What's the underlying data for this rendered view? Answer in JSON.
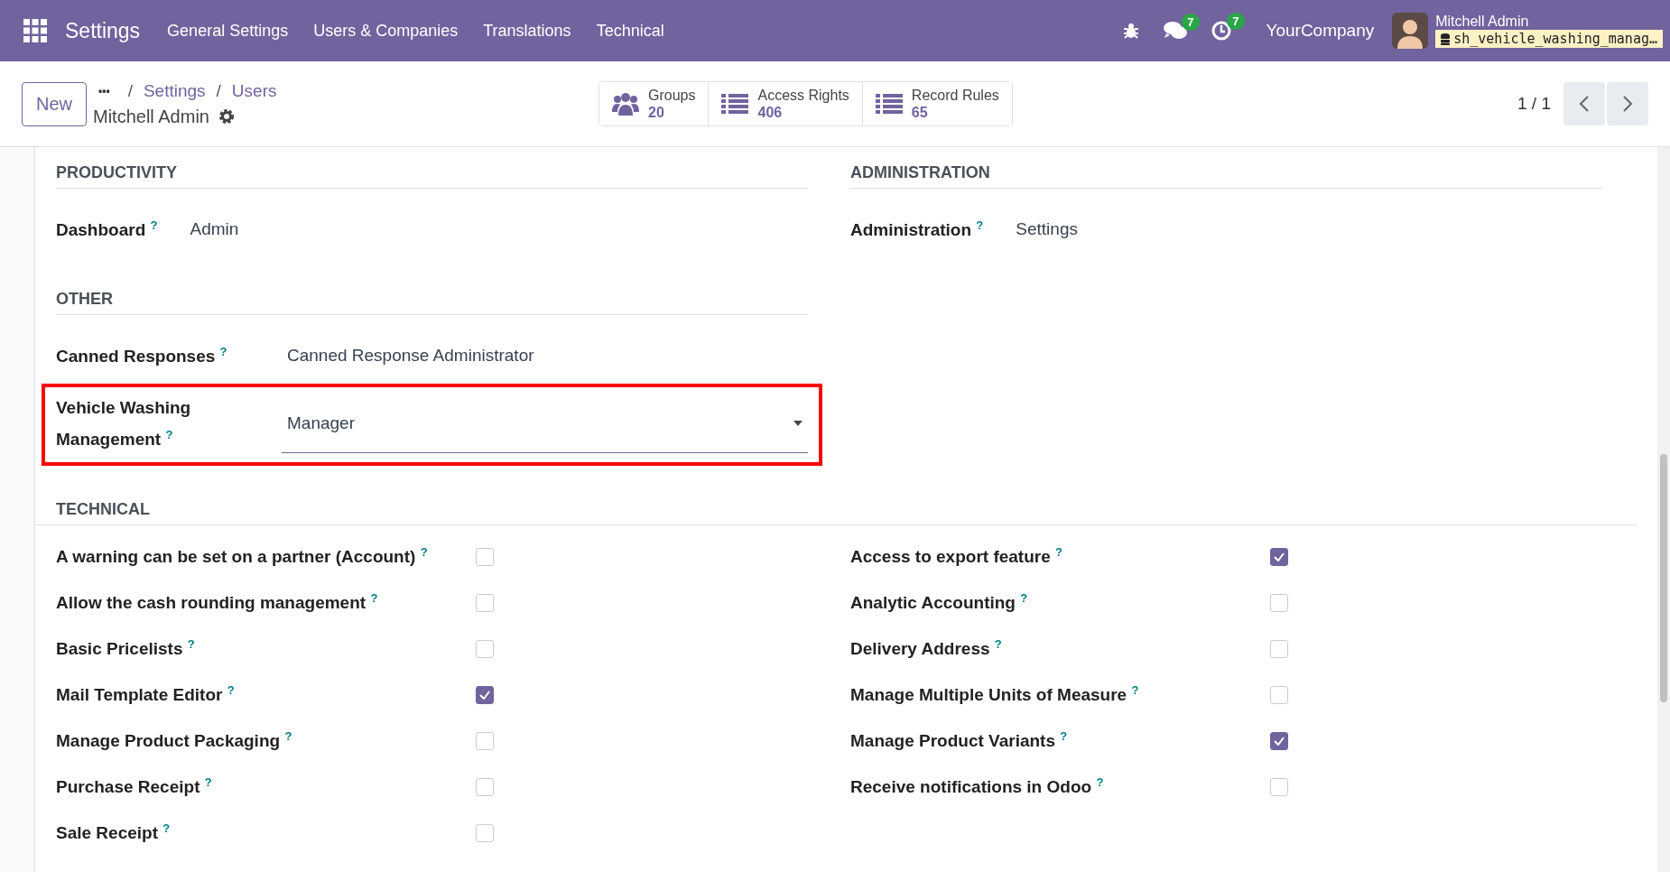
{
  "navbar": {
    "app_title": "Settings",
    "menus": [
      "General Settings",
      "Users & Companies",
      "Translations",
      "Technical"
    ],
    "messages_count": "7",
    "activities_count": "7",
    "company": "YourCompany",
    "user_name": "Mitchell Admin",
    "database": "sh_vehicle_washing_manag…"
  },
  "control_panel": {
    "new_button": "New",
    "breadcrumb_more": "•••",
    "breadcrumb_separator": "/",
    "breadcrumbs": [
      "Settings",
      "Users"
    ],
    "record_title": "Mitchell Admin",
    "stat_buttons": [
      {
        "kind": "users",
        "label": "Groups",
        "count": "20"
      },
      {
        "kind": "list",
        "label": "Access Rights",
        "count": "406"
      },
      {
        "kind": "list",
        "label": "Record Rules",
        "count": "65"
      }
    ],
    "pager": "1 / 1"
  },
  "sections": [
    {
      "title": "PRODUCTIVITY",
      "fields": [
        {
          "label": "Dashboard",
          "help": "?",
          "value": "Admin",
          "kind": "text",
          "highlighted": false
        }
      ]
    },
    {
      "title": "ADMINISTRATION",
      "fields": [
        {
          "label": "Administration",
          "help": "?",
          "value": "Settings",
          "kind": "text",
          "highlighted": false
        }
      ]
    },
    {
      "title": "OTHER",
      "fields": [
        {
          "label": "Canned Responses",
          "help": "?",
          "value": "Canned Response Administrator",
          "kind": "text",
          "highlighted": false
        },
        {
          "label": "Vehicle Washing Management",
          "help": "?",
          "value": "Manager",
          "kind": "select",
          "highlighted": true
        }
      ]
    }
  ],
  "technical": {
    "title": "TECHNICAL",
    "left": [
      {
        "label": "A warning can be set on a partner (Account)",
        "help": "?",
        "checked": false
      },
      {
        "label": "Allow the cash rounding management",
        "help": "?",
        "checked": false
      },
      {
        "label": "Basic Pricelists",
        "help": "?",
        "checked": false
      },
      {
        "label": "Mail Template Editor",
        "help": "?",
        "checked": true
      },
      {
        "label": "Manage Product Packaging",
        "help": "?",
        "checked": false
      },
      {
        "label": "Purchase Receipt",
        "help": "?",
        "checked": false
      },
      {
        "label": "Sale Receipt",
        "help": "?",
        "checked": false
      }
    ],
    "right": [
      {
        "label": "Access to export feature",
        "help": "?",
        "checked": true
      },
      {
        "label": "Analytic Accounting",
        "help": "?",
        "checked": false
      },
      {
        "label": "Delivery Address",
        "help": "?",
        "checked": false
      },
      {
        "label": "Manage Multiple Units of Measure",
        "help": "?",
        "checked": false
      },
      {
        "label": "Manage Product Variants",
        "help": "?",
        "checked": true
      },
      {
        "label": "Receive notifications in Odoo",
        "help": "?",
        "checked": false
      }
    ]
  }
}
